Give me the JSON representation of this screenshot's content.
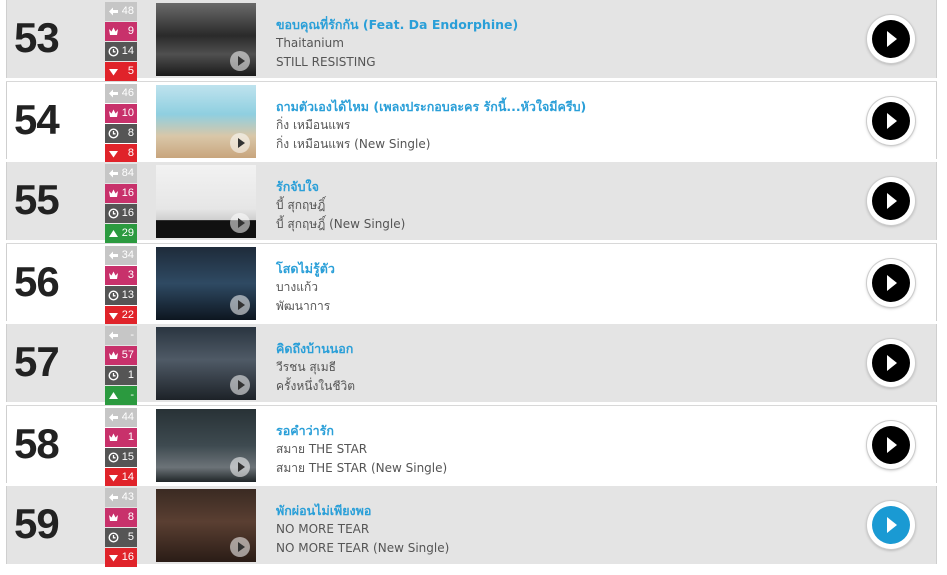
{
  "rows": [
    {
      "rank": "53",
      "prev": "48",
      "peak": "9",
      "weeks": "14",
      "move": "5",
      "dir": "down",
      "title": "ขอบคุณที่รักกัน (Feat. Da Endorphine)",
      "artist": "Thaitanium",
      "album": "STILL RESISTING",
      "scene": "bw"
    },
    {
      "rank": "54",
      "prev": "46",
      "peak": "10",
      "weeks": "8",
      "move": "8",
      "dir": "down",
      "title": "ถามตัวเองได้ไหม (เพลงประกอบละคร รักนี้...หัวใจมีครีบ)",
      "artist": "กิ่ง เหมือนแพร",
      "album": "กิ่ง เหมือนแพร (New Single)",
      "scene": "beach"
    },
    {
      "rank": "55",
      "prev": "84",
      "peak": "16",
      "weeks": "16",
      "move": "29",
      "dir": "up",
      "title": "รักจับใจ",
      "artist": "บี้ สุกฤษฎิ์",
      "album": "บี้ สุกฤษฎิ์ (New Single)",
      "scene": "studio"
    },
    {
      "rank": "56",
      "prev": "34",
      "peak": "3",
      "weeks": "13",
      "move": "22",
      "dir": "down",
      "title": "โสดไม่รู้ตัว",
      "artist": "บางแก้ว",
      "album": "พัฒนาการ",
      "scene": "blue"
    },
    {
      "rank": "57",
      "prev": "-",
      "peak": "57",
      "weeks": "1",
      "move": "-",
      "dir": "up",
      "title": "คิดถึงบ้านนอก",
      "artist": "วีรชน สุเมธี",
      "album": "ครั้งหนึ่งในชีวิต",
      "scene": "band"
    },
    {
      "rank": "58",
      "prev": "44",
      "peak": "1",
      "weeks": "15",
      "move": "14",
      "dir": "down",
      "title": "รอคำว่ารัก",
      "artist": "สมาย THE STAR",
      "album": "สมาย THE STAR (New Single)",
      "scene": "night"
    },
    {
      "rank": "59",
      "prev": "43",
      "peak": "8",
      "weeks": "5",
      "move": "16",
      "dir": "down",
      "title": "พักผ่อนไม่เพียงพอ",
      "artist": "NO MORE TEAR",
      "album": "NO MORE TEAR (New Single)",
      "scene": "dark",
      "active": true
    }
  ]
}
